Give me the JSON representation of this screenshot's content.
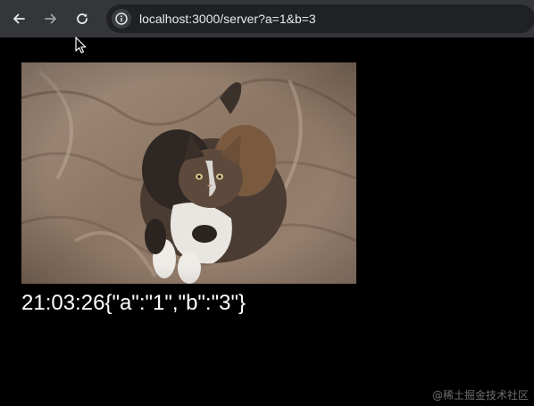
{
  "browser": {
    "url": "localhost:3000/server?a=1&b=3",
    "icons": {
      "back": "arrow-left-icon",
      "forward": "arrow-right-icon",
      "reload": "reload-icon",
      "site_info": "info-icon",
      "cursor": "mouse-pointer-icon"
    }
  },
  "page": {
    "image": {
      "subject": "calico cat lying on a beige blanket",
      "kind": "photo"
    },
    "output_text": "21:03:26{\"a\":\"1\",\"b\":\"3\"}"
  },
  "watermark": "@稀土掘金技术社区",
  "colors": {
    "toolbar": "#35363a",
    "omnibox": "#202124",
    "page_background": "#000000",
    "text": "#ffffff"
  }
}
